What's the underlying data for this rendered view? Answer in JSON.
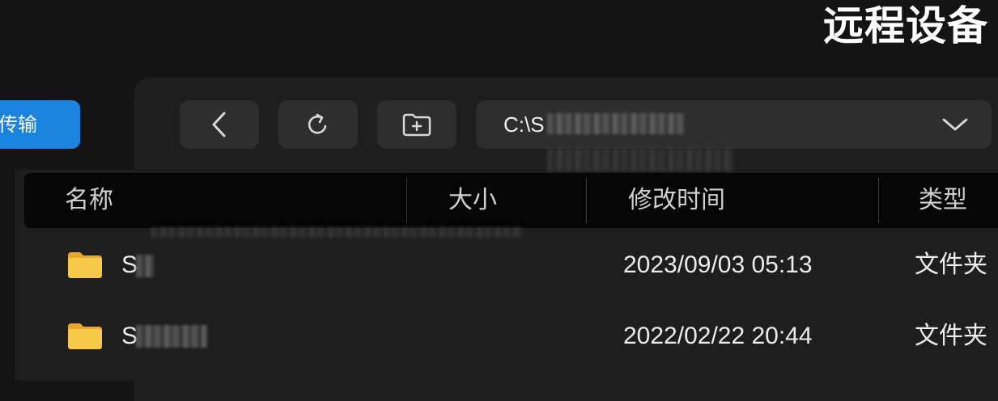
{
  "header": {
    "title": "远程设备"
  },
  "sidebar": {
    "transfer_label": "传输"
  },
  "toolbar": {
    "back_icon": "chevron-left-icon",
    "refresh_icon": "refresh-icon",
    "new_folder_icon": "new-folder-icon",
    "path_value": "C:\\S",
    "path_dropdown_icon": "chevron-down-icon"
  },
  "table": {
    "columns": [
      "名称",
      "大小",
      "修改时间",
      "类型"
    ],
    "rows": [
      {
        "name": "S",
        "size": "",
        "modified": "2023/09/03 05:13",
        "type": "文件夹",
        "icon": "folder-icon"
      },
      {
        "name": "S",
        "size": "",
        "modified": "2022/02/22 20:44",
        "type": "文件夹",
        "icon": "folder-icon"
      }
    ]
  },
  "colors": {
    "background": "#141414",
    "panel": "#1e1e1e",
    "control": "#2e2e2e",
    "header_bar": "#050505",
    "accent": "#1a83e0",
    "folder": "#f7c948"
  }
}
